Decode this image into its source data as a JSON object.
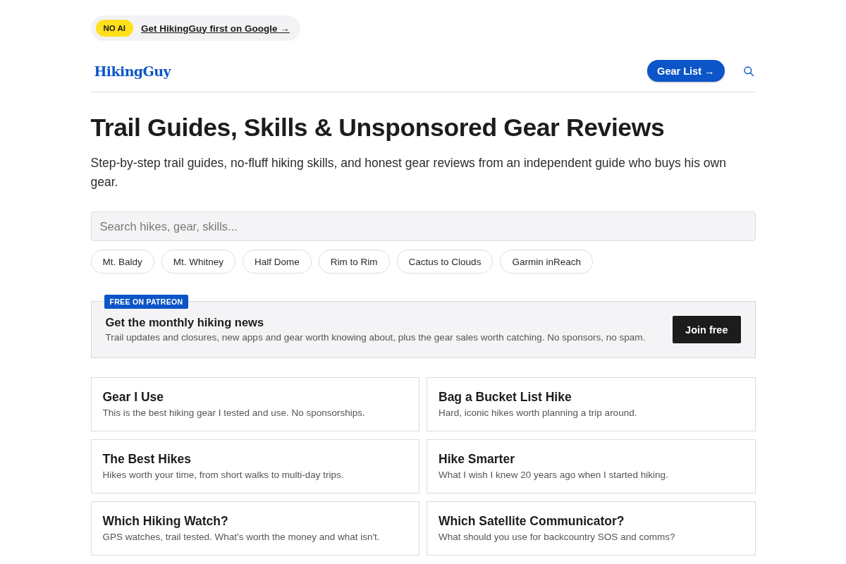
{
  "promo": {
    "badge": "NO AI",
    "link": "Get HikingGuy first on Google →"
  },
  "header": {
    "logo": "HikingGuy",
    "button": "Gear List →"
  },
  "hero": {
    "title": "Trail Guides, Skills & Unsponsored Gear Reviews",
    "subtitle": "Step-by-step trail guides, no-fluff hiking skills, and honest gear reviews from an independent guide who buys his own gear."
  },
  "search": {
    "placeholder": "Search hikes, gear, skills..."
  },
  "chips": [
    "Mt. Baldy",
    "Mt. Whitney",
    "Half Dome",
    "Rim to Rim",
    "Cactus to Clouds",
    "Garmin inReach"
  ],
  "newsletter": {
    "badge": "FREE ON PATREON",
    "title": "Get the monthly hiking news",
    "text": "Trail updates and closures, new apps and gear worth knowing about, plus the gear sales worth catching. No sponsors, no spam.",
    "button": "Join free"
  },
  "cards": [
    {
      "title": "Gear I Use",
      "text": "This is the best hiking gear I tested and use. No sponsorships."
    },
    {
      "title": "Bag a Bucket List Hike",
      "text": "Hard, iconic hikes worth planning a trip around."
    },
    {
      "title": "The Best Hikes",
      "text": "Hikes worth your time, from short walks to multi-day trips."
    },
    {
      "title": "Hike Smarter",
      "text": "What I wish I knew 20 years ago when I started hiking."
    },
    {
      "title": "Which Hiking Watch?",
      "text": "GPS watches, trail tested. What's worth the money and what isn't."
    },
    {
      "title": "Which Satellite Communicator?",
      "text": "What should you use for backcountry SOS and comms?"
    }
  ]
}
